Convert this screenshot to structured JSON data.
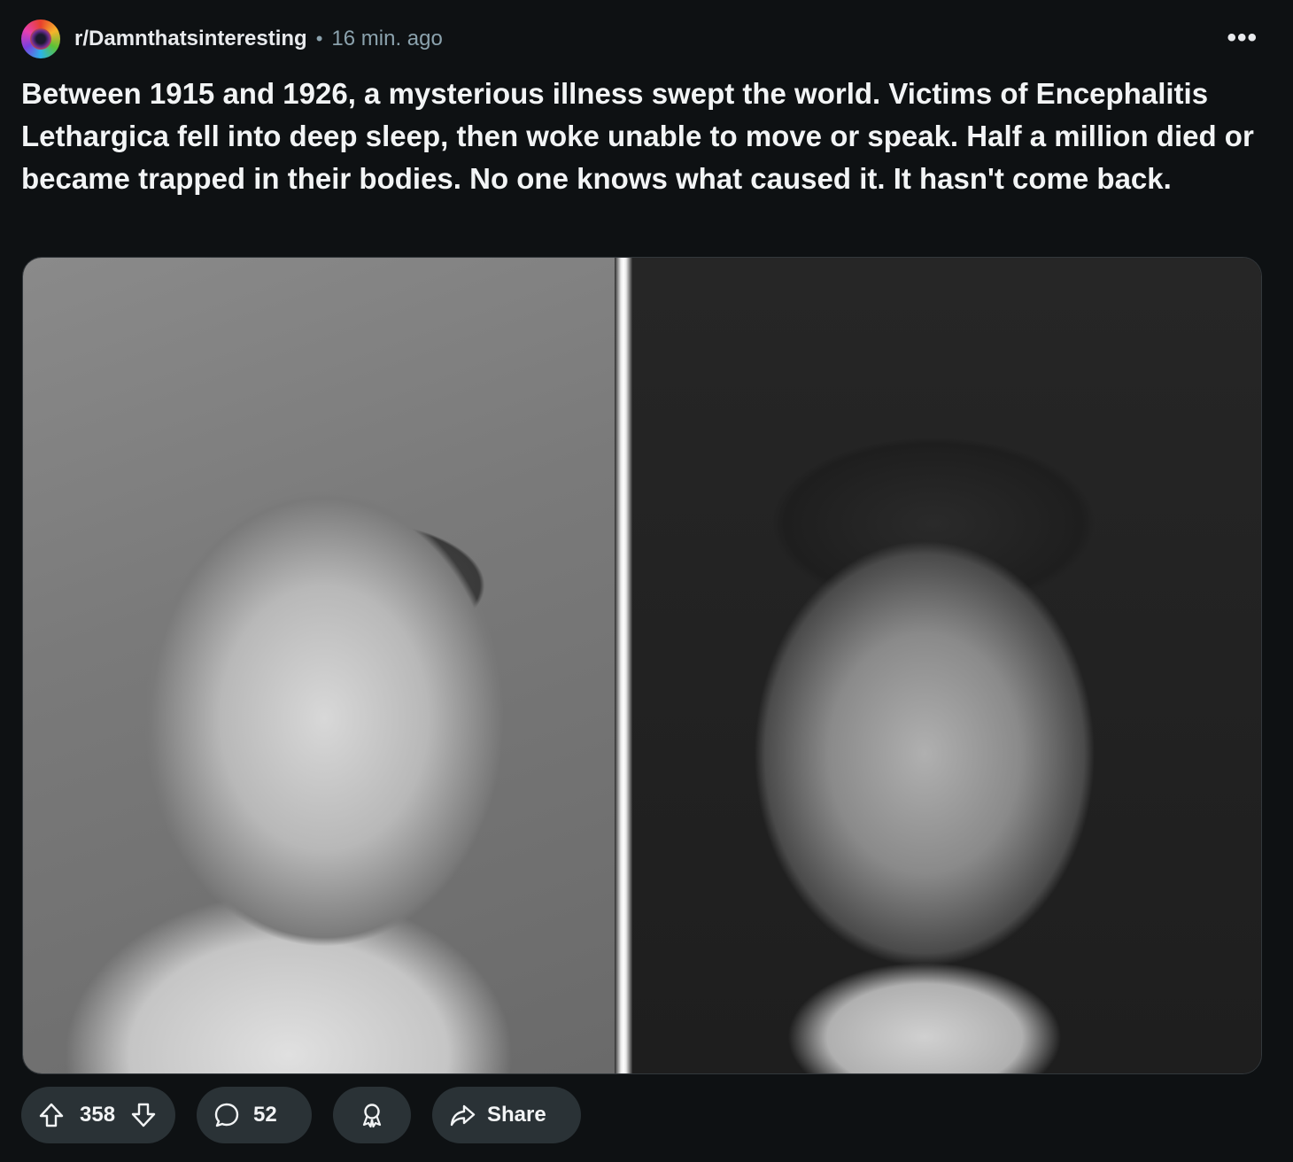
{
  "post": {
    "subreddit": "r/Damnthatsinteresting",
    "separator": "•",
    "time": "16 min. ago",
    "more_label": "•••",
    "title": "Between 1915 and 1926, a mysterious illness swept the world. Victims of Encephalitis Lethargica fell into deep sleep, then woke unable to move or speak. Half a million died or became trapped in their bodies. No one knows what caused it. It hasn't come back.",
    "media": {
      "left_image": "black-and-white photo of a man with eyes rolled upward",
      "right_image": "black-and-white photo of a man looking upward and sideways"
    }
  },
  "actions": {
    "votes": "358",
    "comments": "52",
    "share_label": "Share"
  },
  "colors": {
    "background": "#0e1113",
    "pill": "#2a3236",
    "text": "#f2f4f5",
    "muted": "#8ba2ad"
  },
  "icons": [
    "upvote-icon",
    "downvote-icon",
    "comment-icon",
    "award-icon",
    "share-icon",
    "more-icon"
  ]
}
